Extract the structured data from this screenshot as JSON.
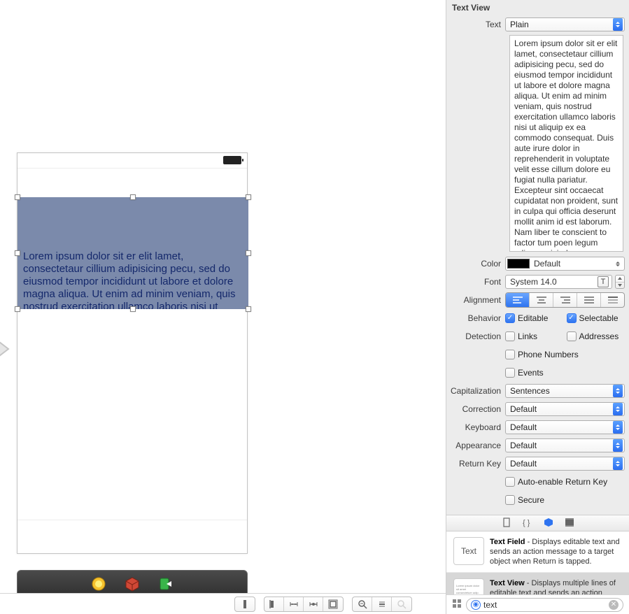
{
  "canvas": {
    "text_view_text": "Lorem ipsum dolor sit er elit lamet, consectetaur cillium adipisicing pecu, sed do eiusmod tempor incididunt ut labore et dolore magna aliqua. Ut enim ad minim veniam, quis nostrud exercitation ullamco laboris nisi ut"
  },
  "inspector": {
    "title": "Text View",
    "text_label": "Text",
    "text_type": "Plain",
    "text_content": "Lorem ipsum dolor sit er elit lamet, consectetaur cillium adipisicing pecu, sed do eiusmod tempor incididunt ut labore et dolore magna aliqua. Ut enim ad minim veniam, quis nostrud exercitation ullamco laboris nisi ut aliquip ex ea commodo consequat. Duis aute irure dolor in reprehenderit in voluptate velit esse cillum dolore eu fugiat nulla pariatur. Excepteur sint occaecat cupidatat non proident, sunt in culpa qui officia deserunt mollit anim id est laborum. Nam liber te conscient to factor tum poen legum odioque civiuda.",
    "color_label": "Color",
    "color_value": "Default",
    "font_label": "Font",
    "font_value": "System 14.0",
    "alignment_label": "Alignment",
    "behavior_label": "Behavior",
    "behavior_editable": "Editable",
    "behavior_selectable": "Selectable",
    "detection_label": "Detection",
    "detection_links": "Links",
    "detection_addresses": "Addresses",
    "detection_phone": "Phone Numbers",
    "detection_events": "Events",
    "capitalization_label": "Capitalization",
    "capitalization_value": "Sentences",
    "correction_label": "Correction",
    "correction_value": "Default",
    "keyboard_label": "Keyboard",
    "keyboard_value": "Default",
    "appearance_label": "Appearance",
    "appearance_value": "Default",
    "return_key_label": "Return Key",
    "return_key_value": "Default",
    "auto_enable_label": "Auto-enable Return Key",
    "secure_label": "Secure"
  },
  "library": {
    "items": [
      {
        "title": "Text Field",
        "thumb_text": "Text",
        "desc": " - Displays editable text and sends an action message to a target object when Return is tapped."
      },
      {
        "title": "Text View",
        "thumb_text": "Lorem ipsum dolor sit amet consectetuer adip. Proin consequat  ante.",
        "desc": " - Displays multiple lines of editable text and sends an action message to a target object when…"
      }
    ],
    "filter_text": "text"
  }
}
